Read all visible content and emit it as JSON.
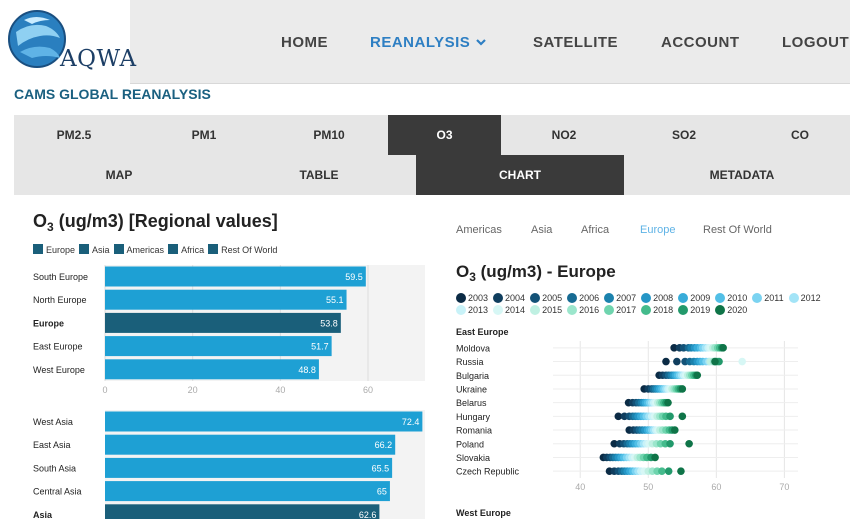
{
  "brand": {
    "name": "AQWA"
  },
  "nav": {
    "items": [
      "HOME",
      "REANALYSIS",
      "SATELLITE",
      "ACCOUNT",
      "LOGOUT"
    ],
    "active": "REANALYSIS"
  },
  "page": {
    "subtitle": "CAMS GLOBAL REANALYSIS"
  },
  "pollutant_tabs": {
    "items": [
      "PM2.5",
      "PM1",
      "PM10",
      "O3",
      "NO2",
      "SO2",
      "CO"
    ],
    "selected": "O3"
  },
  "view_tabs": {
    "items": [
      "MAP",
      "TABLE",
      "CHART",
      "METADATA"
    ],
    "selected": "CHART"
  },
  "left_chart": {
    "title_main": "O",
    "title_sub": "3",
    "title_rest": " (ug/m3) [Regional values]",
    "legend": [
      "Europe",
      "Asia",
      "Americas",
      "Africa",
      "Rest Of World"
    ],
    "legend_color": "#1a5f7a"
  },
  "region_tabs": {
    "items": [
      "Americas",
      "Asia",
      "Africa",
      "Europe",
      "Rest Of World"
    ],
    "selected": "Europe"
  },
  "right_chart": {
    "title_main": "O",
    "title_sub": "3",
    "title_rest": " (ug/m3) - Europe",
    "group_title": "East Europe",
    "next_group_title": "West Europe"
  },
  "colors": {
    "bar": "#1ea0d4",
    "bar_group": "#1a5f7a",
    "nav_active": "#2e7fc3",
    "tab_selected": "#3a3a3a",
    "region_selected": "#5fb3e6"
  },
  "chart_data": [
    {
      "type": "bar",
      "orientation": "horizontal",
      "panel": "europe",
      "categories": [
        "South Europe",
        "North Europe",
        "Europe",
        "East Europe",
        "West Europe"
      ],
      "values": [
        59.5,
        55.1,
        53.8,
        51.7,
        48.8
      ],
      "highlight": [
        "Europe"
      ],
      "xlim": [
        0,
        73
      ],
      "xticks": [
        0,
        20,
        40,
        60
      ]
    },
    {
      "type": "bar",
      "orientation": "horizontal",
      "panel": "asia",
      "categories": [
        "West Asia",
        "East Asia",
        "South Asia",
        "Central Asia",
        "Asia"
      ],
      "values": [
        72.4,
        66.2,
        65.5,
        65,
        62.6
      ],
      "highlight": [
        "Asia"
      ],
      "xlim": [
        0,
        73
      ]
    },
    {
      "type": "scatter",
      "panel": "east-europe-years",
      "series_names": [
        "2003",
        "2004",
        "2005",
        "2006",
        "2007",
        "2008",
        "2009",
        "2010",
        "2011",
        "2012",
        "2013",
        "2014",
        "2015",
        "2016",
        "2017",
        "2018",
        "2019",
        "2020"
      ],
      "series_colors": [
        "#0b2b45",
        "#103e5e",
        "#135277",
        "#176b93",
        "#1b82ad",
        "#2596c6",
        "#38acd9",
        "#52bfe6",
        "#7bd3f1",
        "#a3e4f7",
        "#c8f2f8",
        "#d7f7f5",
        "#bff0e2",
        "#9be6cc",
        "#6fd4ae",
        "#44bb8c",
        "#22996b",
        "#0f7448"
      ],
      "categories": [
        "Moldova",
        "Russia",
        "Bulgaria",
        "Ukraine",
        "Belarus",
        "Hungary",
        "Romania",
        "Poland",
        "Slovakia",
        "Czech Republic"
      ],
      "values": [
        [
          53.8,
          54.6,
          55.2,
          55.9,
          56.3,
          56.8,
          57.2,
          57.7,
          58.0,
          58.4,
          58.8,
          59.1,
          59.5,
          59.8,
          60.2,
          60.5,
          60.8,
          61.0
        ],
        [
          52.6,
          54.2,
          55.4,
          56.1,
          56.7,
          57.2,
          57.6,
          58.0,
          58.5,
          58.9,
          59.4,
          63.8,
          59.1,
          59.6,
          59.9,
          60.1,
          60.4,
          59.8
        ],
        [
          51.6,
          52.1,
          52.6,
          53.0,
          53.4,
          53.7,
          54.0,
          54.3,
          54.6,
          54.9,
          55.2,
          55.5,
          55.8,
          56.1,
          56.4,
          56.7,
          57.0,
          57.2
        ],
        [
          49.4,
          50.0,
          50.5,
          50.8,
          51.1,
          51.4,
          51.7,
          52.0,
          52.3,
          52.6,
          52.9,
          53.2,
          53.5,
          53.8,
          54.1,
          54.4,
          54.7,
          55.0
        ],
        [
          47.1,
          47.7,
          48.2,
          48.6,
          49.0,
          49.3,
          49.6,
          49.9,
          50.2,
          50.5,
          50.8,
          51.1,
          51.4,
          51.7,
          52.0,
          52.3,
          52.6,
          52.9
        ],
        [
          45.6,
          46.5,
          47.2,
          47.7,
          48.1,
          48.5,
          48.9,
          49.3,
          49.7,
          50.1,
          50.5,
          50.9,
          51.3,
          51.7,
          52.1,
          52.6,
          53.2,
          55.0
        ],
        [
          47.2,
          47.8,
          48.3,
          48.7,
          49.1,
          49.5,
          49.9,
          50.2,
          50.5,
          50.8,
          51.1,
          51.4,
          51.7,
          52.1,
          52.6,
          53.1,
          53.5,
          53.9
        ],
        [
          45.0,
          45.8,
          46.4,
          46.9,
          47.3,
          47.7,
          48.1,
          48.5,
          48.9,
          49.3,
          49.7,
          50.1,
          50.6,
          51.2,
          51.8,
          52.5,
          53.2,
          56.0
        ],
        [
          43.4,
          43.9,
          44.4,
          44.8,
          45.2,
          45.6,
          46.0,
          46.4,
          46.8,
          47.2,
          47.6,
          48.0,
          48.4,
          48.8,
          49.3,
          49.8,
          50.4,
          51.0
        ],
        [
          44.3,
          45.0,
          45.6,
          46.1,
          46.5,
          46.9,
          47.3,
          47.7,
          48.1,
          48.5,
          48.9,
          49.4,
          50.0,
          50.6,
          51.3,
          52.0,
          53.0,
          54.8
        ]
      ],
      "xlim": [
        36,
        72
      ],
      "xticks": [
        40,
        50,
        60,
        70
      ]
    }
  ]
}
